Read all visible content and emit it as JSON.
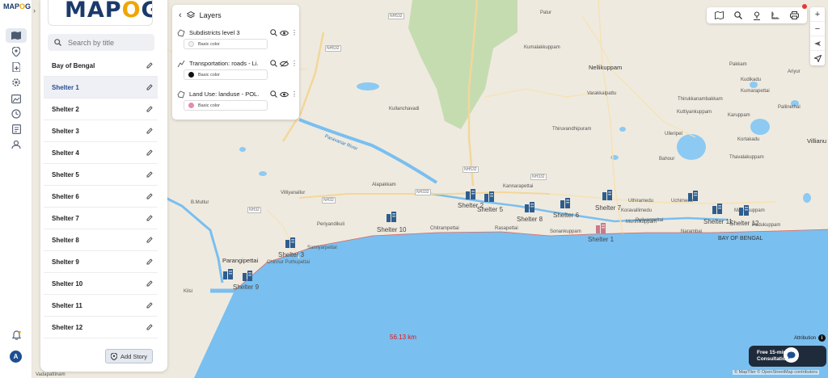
{
  "app": {
    "logo_text": "MAPOG",
    "logo_prefix": "MAP",
    "logo_accent": "O",
    "logo_suffix": "G"
  },
  "rail": {
    "icons": [
      "map-icon",
      "location-pin-icon",
      "file-add-icon",
      "settings-gear-icon",
      "image-edit-icon",
      "clock-icon",
      "document-list-icon",
      "people-map-icon"
    ],
    "bottom_icons": [
      "notification-bell-icon"
    ],
    "avatar_initial": "A"
  },
  "story_panel": {
    "search_placeholder": "Search by title",
    "items": [
      {
        "title": "Bay of Bengal",
        "active": false
      },
      {
        "title": "Shelter 1",
        "active": true
      },
      {
        "title": "Shelter 2",
        "active": false
      },
      {
        "title": "Shelter 3",
        "active": false
      },
      {
        "title": "Shelter 4",
        "active": false
      },
      {
        "title": "Shelter 5",
        "active": false
      },
      {
        "title": "Shelter 6",
        "active": false
      },
      {
        "title": "Shelter 7",
        "active": false
      },
      {
        "title": "Shelter 8",
        "active": false
      },
      {
        "title": "Shelter 9",
        "active": false
      },
      {
        "title": "Shelter 10",
        "active": false
      },
      {
        "title": "Shelter 11",
        "active": false
      },
      {
        "title": "Shelter 12",
        "active": false
      }
    ],
    "add_story_label": "Add Story"
  },
  "layers_panel": {
    "title": "Layers",
    "layers": [
      {
        "title": "Subdistricts level 3",
        "color_label": "Basic color",
        "color": "#f2f2f2",
        "icon": "polygon-icon"
      },
      {
        "title": "Transportation: roads - Li...",
        "color_label": "Basic color",
        "color": "#111111",
        "icon": "line-icon"
      },
      {
        "title": "Land Use: landuse - POL...",
        "color_label": "Basic color",
        "color": "#e68ab4",
        "icon": "polygon-icon"
      }
    ]
  },
  "map": {
    "places": [
      "Nellikuppam",
      "Villianu",
      "Parangipettai",
      "BAY OF BENGAL",
      "Kullanchavadi",
      "Alapakkam",
      "Villiyanallur",
      "B.Mutlur",
      "Periyandikuli",
      "Chinnur Puthupettai",
      "Samiyarpettai",
      "Chitrampettai",
      "Rasapettai",
      "Sonankuppam",
      "Kannarapettai",
      "Varakkalpattu",
      "Thiruvandhipuram",
      "Koravallimedu",
      "Manjakuppam",
      "Bahour",
      "Kuttiyankuppam",
      "Pallinethal",
      "Thavalakuppam",
      "Kilsi",
      "Ariyur",
      "Pakkam",
      "Kudikadu",
      "Thirukkanambakkam",
      "Karuppam",
      "Uthiramedu",
      "Narambai",
      "Murthikuppam",
      "Pudukuppam",
      "Uchimedu",
      "Pulivanpettai",
      "Kortakadu",
      "Ulleripet",
      "Kumalakkuppam",
      "Kumarapettai",
      "Palur"
    ],
    "shelters": [
      {
        "name": "Shelter 1"
      },
      {
        "name": "Shelter 2"
      },
      {
        "name": "Shelter 3"
      },
      {
        "name": "Shelter 5"
      },
      {
        "name": "Shelter 6"
      },
      {
        "name": "Shelter 7"
      },
      {
        "name": "Shelter 8"
      },
      {
        "name": "Shelter 9"
      },
      {
        "name": "Shelter 10"
      },
      {
        "name": "Shelter 11"
      },
      {
        "name": "Shelter 12"
      }
    ],
    "roads": [
      "NH532",
      "NH532",
      "NH532",
      "NH32",
      "NH32",
      "NH332",
      "NH332"
    ],
    "lake_label": "Paravanar River",
    "scale_text": "56.13 km",
    "attribution_label": "Attribution",
    "consult_line1": "Free 15-min Map",
    "consult_line2": "Consultation",
    "copyright": "© MapTiler © OpenStreetMap contributors",
    "bottom_town": "Vadapattinam"
  },
  "toolbar": {
    "tools": [
      "map-edit-icon",
      "search-icon",
      "person-pin-icon",
      "measure-icon",
      "print-icon"
    ],
    "zoom_in": "+",
    "zoom_out": "−"
  },
  "colors": {
    "brand_dark": "#1b3a6b",
    "brand_accent": "#f0a500",
    "sea": "#79bff0",
    "land": "#efeadf",
    "forest": "#c5dcb1",
    "shelter_icon": "#2e5d8f",
    "shelter1_icon": "#c97a8a"
  }
}
